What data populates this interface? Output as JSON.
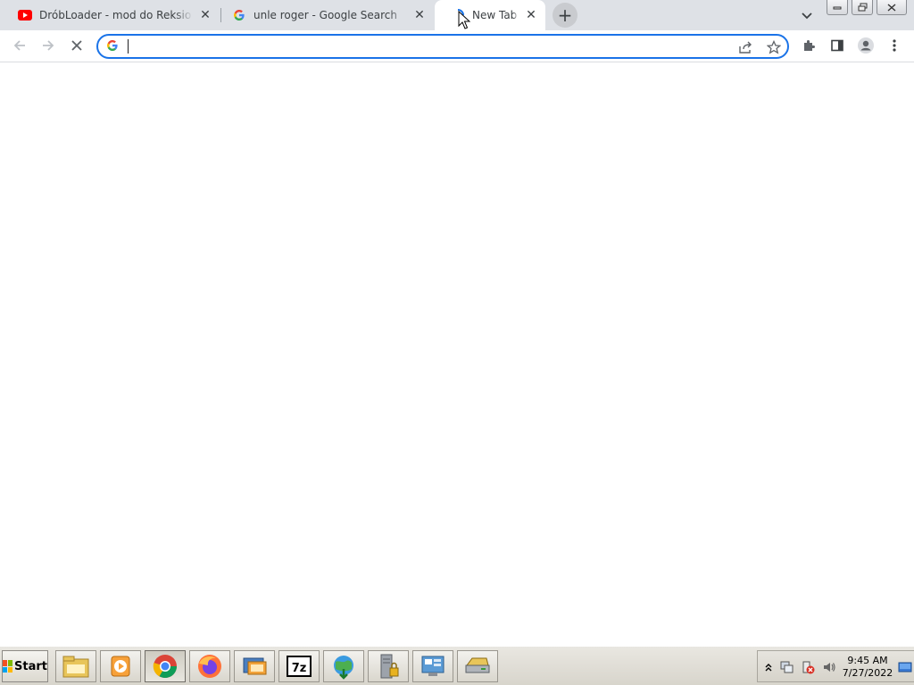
{
  "tabs": [
    {
      "title": "DróbLoader - mod do Reksio i Czarodzieje",
      "favicon": "youtube-icon",
      "active": false
    },
    {
      "title": "unle roger - Google Search",
      "favicon": "google-icon",
      "active": false
    },
    {
      "title": "New Tab",
      "favicon": "loading-icon",
      "active": true
    }
  ],
  "toolbar": {
    "omnibox_value": "",
    "omnibox_placeholder": ""
  },
  "taskbar": {
    "start_label": "Start",
    "items": [
      "file-explorer-icon",
      "media-player-icon",
      "chrome-icon",
      "firefox-icon",
      "remote-desktop-icon",
      "7zip-icon",
      "internet-download-manager-icon",
      "server-lock-icon",
      "control-panel-icon",
      "drive-icon"
    ],
    "clock_time": "9:45 AM",
    "clock_date": "7/27/2022"
  },
  "colors": {
    "tabstrip": "#dee1e6",
    "accent": "#1a73e8",
    "youtube_red": "#ff0000"
  }
}
